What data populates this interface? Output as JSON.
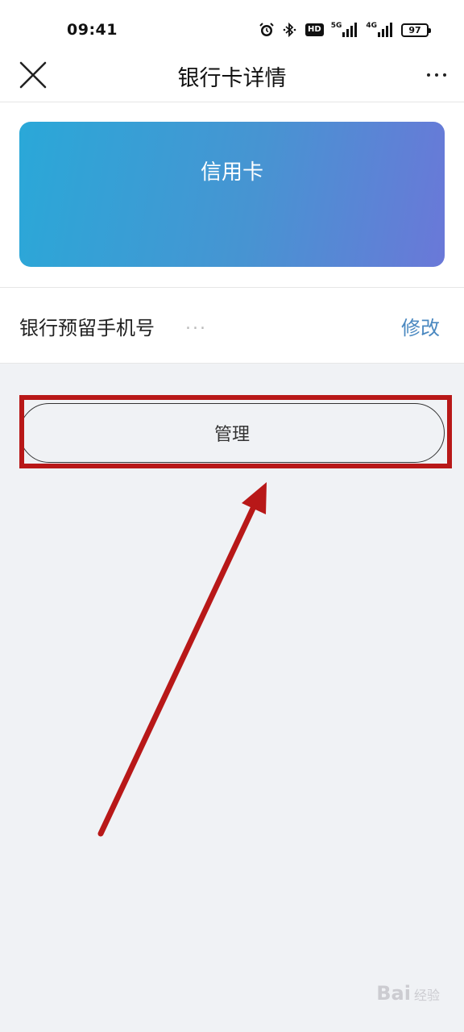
{
  "status_bar": {
    "time": "09:41",
    "icons": [
      "alarm-icon",
      "bluetooth-icon",
      "hd-icon",
      "signal-5g-icon",
      "signal-4g-icon",
      "battery-icon"
    ],
    "hd_label": "HD",
    "net1": "5G",
    "net2": "4G",
    "battery": "97"
  },
  "nav": {
    "title": "银行卡详情"
  },
  "card": {
    "title": "信用卡",
    "colors": [
      "#2aa8d8",
      "#6a78d8"
    ]
  },
  "phone_row": {
    "label": "银行预留手机号",
    "value": "...",
    "action": "修改"
  },
  "manage_button": {
    "label": "管理"
  },
  "annotation": {
    "color": "#b81818"
  },
  "watermark": {
    "brand": "Bai",
    "suffix": "经验"
  }
}
